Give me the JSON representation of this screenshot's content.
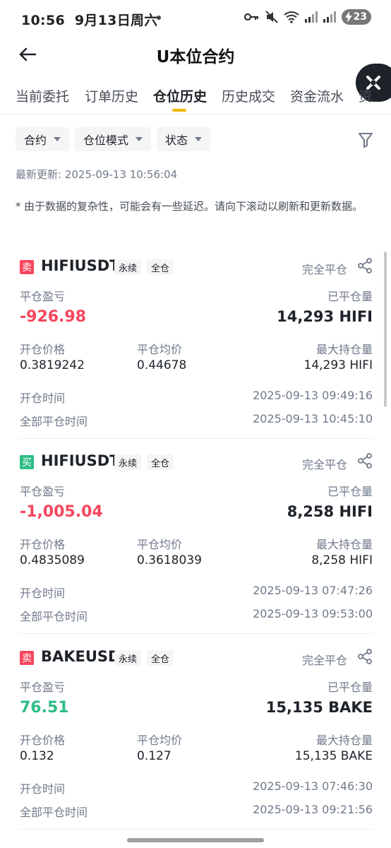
{
  "status_bar": {
    "time": "10:56",
    "date": "9月13日周六",
    "battery": "23"
  },
  "header": {
    "title": "U本位合约"
  },
  "tabs": [
    {
      "label": "当前委托",
      "active": false
    },
    {
      "label": "订单历史",
      "active": false
    },
    {
      "label": "仓位历史",
      "active": true
    },
    {
      "label": "历史成交",
      "active": false
    },
    {
      "label": "资金流水",
      "active": false
    },
    {
      "label": "资",
      "active": false
    }
  ],
  "filters": [
    {
      "label": "合约"
    },
    {
      "label": "仓位模式"
    },
    {
      "label": "状态"
    }
  ],
  "last_updated": "最新更新: 2025-09-13 10:56:04",
  "note": {
    "star": "*",
    "text": "由于数据的复杂性，可能会有一些延迟。请向下滚动以刷新和更新数据。"
  },
  "labels": {
    "pnl": "平仓盈亏",
    "closed_qty": "已平仓量",
    "open_price": "开仓价格",
    "close_avg": "平仓均价",
    "max_hold": "最大持仓量",
    "open_time": "开仓时间",
    "full_close_time": "全部平仓时间"
  },
  "colors": {
    "sell": "#f6465d",
    "buy": "#2ebd85",
    "accent": "#f0b90b"
  },
  "positions": [
    {
      "side": "卖",
      "side_type": "sell",
      "symbol": "HIFIUSDT",
      "tag_perpetual": "永续",
      "tag_margin": "全仓",
      "status": "完全平仓",
      "pnl": "-926.98",
      "pnl_type": "loss",
      "closed_qty": "14,293 HIFI",
      "open_price": "0.3819242",
      "close_avg": "0.44678",
      "max_hold": "14,293 HIFI",
      "open_time": "2025-09-13 09:49:16",
      "full_close_time": "2025-09-13 10:45:10"
    },
    {
      "side": "买",
      "side_type": "buy",
      "symbol": "HIFIUSDT",
      "tag_perpetual": "永续",
      "tag_margin": "全仓",
      "status": "完全平仓",
      "pnl": "-1,005.04",
      "pnl_type": "loss",
      "closed_qty": "8,258 HIFI",
      "open_price": "0.4835089",
      "close_avg": "0.3618039",
      "max_hold": "8,258 HIFI",
      "open_time": "2025-09-13 07:47:26",
      "full_close_time": "2025-09-13 09:53:00"
    },
    {
      "side": "卖",
      "side_type": "sell",
      "symbol": "BAKEUSDT",
      "tag_perpetual": "永续",
      "tag_margin": "全仓",
      "status": "完全平仓",
      "pnl": "76.51",
      "pnl_type": "profit",
      "closed_qty": "15,135 BAKE",
      "open_price": "0.132",
      "close_avg": "0.127",
      "max_hold": "15,135 BAKE",
      "open_time": "2025-09-13 07:46:30",
      "full_close_time": "2025-09-13 09:21:56"
    }
  ]
}
